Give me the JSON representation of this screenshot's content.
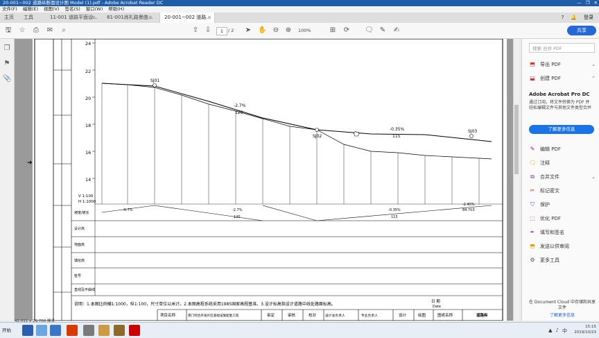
{
  "window": {
    "title": "20-001~002 道路纵断面设计图 Model (1).pdf - Adobe Acrobat Reader DC",
    "controls": [
      "—",
      "❐",
      "✕"
    ]
  },
  "menu": [
    "文件(F)",
    "编辑(E)",
    "视图(V)",
    "签名(S)",
    "窗口(W)",
    "帮助(H)"
  ],
  "tabs": {
    "home": "主页",
    "tools": "工具",
    "items": [
      {
        "label": "11-001 道路平面设..."
      },
      {
        "label": "81-001尚礼路景曲..."
      },
      {
        "label": "20-001~002 道路..."
      }
    ],
    "login": "登录"
  },
  "toolbar": {
    "page_current": "1",
    "page_total": "/ 2",
    "zoom": "100%",
    "share": "共享"
  },
  "right_panel": {
    "search_placeholder": "搜索 合并 PDF",
    "export": "导出 PDF",
    "create": "创建 PDF",
    "promo_title": "Adobe Acrobat Pro DC",
    "promo_text": "通过订阅，将文件转换为 PDF 并轻松编辑文件与其他文件类型合并",
    "promo_button": "了解更多信息",
    "items": [
      "编辑 PDF",
      "注释",
      "合并文件",
      "标记密文",
      "保护",
      "优化 PDF",
      "填写和签名",
      "发送以供审阅",
      "更多工具"
    ],
    "store_text": "在 Document Cloud 中存储和共享文件",
    "store_link": "了解更多信息"
  },
  "drawing": {
    "y_ticks": [
      "24",
      "22",
      "20",
      "18",
      "16",
      "14"
    ],
    "scale": [
      "V 1:100",
      "H 1:1000"
    ],
    "labels": {
      "sj01": "SJ01",
      "sj02": "SJ02",
      "sj03": "SJ03",
      "g1": "-2.7%",
      "l1": "120",
      "g2": "-0.35%",
      "l2": "115",
      "g3": "-0.7%",
      "g4": "-2.45%",
      "l4": "84.703"
    },
    "row_labels": [
      "坡度/坡长",
      "设计高",
      "地面高",
      "填挖高",
      "桩号",
      "直线及平曲线"
    ],
    "note": "说明：1.本图比例横1:1000，纵1:100，尺寸单位以米计。2.本图高程系统采用1985国家高程基准。3.设计标高指设计道路中线处路面标高。",
    "title_block": [
      "项目名称",
      "南门综合开发片区基础设施配套工程",
      "审定",
      "审核",
      "校对",
      "设计总负责人",
      "专业负责人",
      "设计",
      "绘图",
      "图纸名称",
      "道路纵"
    ],
    "date_label": "日 期",
    "date_en": "Date"
  },
  "status": {
    "size": "42.011 x 29.700 厘米"
  },
  "taskbar": {
    "start": "开始",
    "time": "15:15",
    "date": "2019/10/23"
  }
}
